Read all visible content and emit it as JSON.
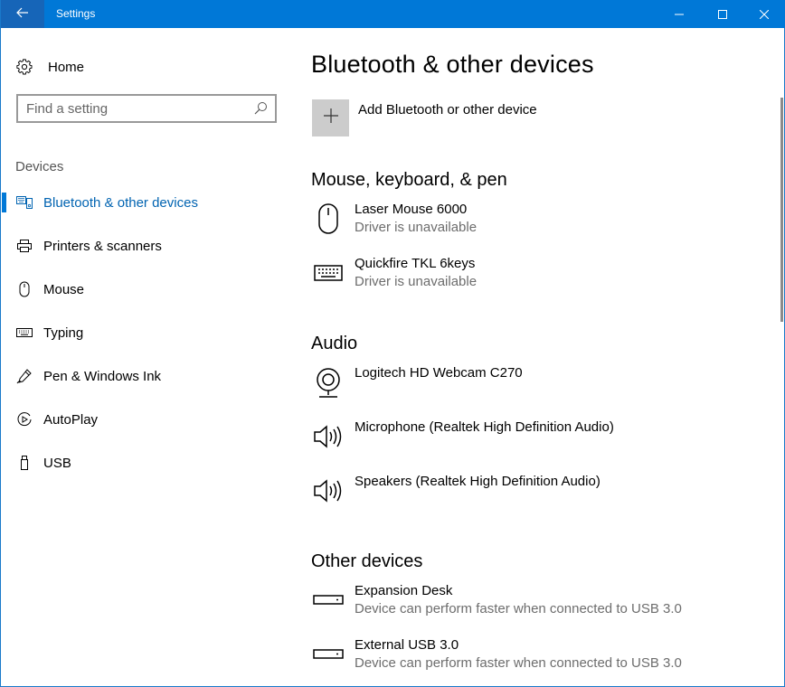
{
  "window": {
    "title": "Settings",
    "accent_color": "#0078d7",
    "controls": [
      "minimize-icon",
      "maximize-icon",
      "close-icon"
    ]
  },
  "sidebar": {
    "home_label": "Home",
    "home_icon": "gear-icon",
    "search": {
      "placeholder": "Find a setting",
      "value": "",
      "icon": "search-icon"
    },
    "section_label": "Devices",
    "items": [
      {
        "label": "Bluetooth & other devices",
        "icon": "bluetooth-devices-icon",
        "active": true
      },
      {
        "label": "Printers & scanners",
        "icon": "printer-icon",
        "active": false
      },
      {
        "label": "Mouse",
        "icon": "mouse-icon",
        "active": false
      },
      {
        "label": "Typing",
        "icon": "keyboard-icon",
        "active": false
      },
      {
        "label": "Pen & Windows Ink",
        "icon": "pen-icon",
        "active": false
      },
      {
        "label": "AutoPlay",
        "icon": "autoplay-icon",
        "active": false
      },
      {
        "label": "USB",
        "icon": "usb-icon",
        "active": false
      }
    ]
  },
  "main": {
    "title": "Bluetooth & other devices",
    "add_device_label": "Add Bluetooth or other device",
    "groups": [
      {
        "title": "Mouse, keyboard, & pen",
        "devices": [
          {
            "name": "Laser Mouse 6000",
            "status": "Driver is unavailable",
            "icon": "mouse-icon"
          },
          {
            "name": "Quickfire TKL 6keys",
            "status": "Driver is unavailable",
            "icon": "keyboard-icon"
          }
        ]
      },
      {
        "title": "Audio",
        "devices": [
          {
            "name": "Logitech HD Webcam C270",
            "status": "",
            "icon": "webcam-icon"
          },
          {
            "name": "Microphone (Realtek High Definition Audio)",
            "status": "",
            "icon": "speaker-icon"
          },
          {
            "name": "Speakers (Realtek High Definition Audio)",
            "status": "",
            "icon": "speaker-icon"
          }
        ]
      },
      {
        "title": "Other devices",
        "devices": [
          {
            "name": "Expansion Desk",
            "status": "Device can perform faster when connected to USB 3.0",
            "icon": "drive-icon"
          },
          {
            "name": "External USB 3.0",
            "status": "Device can perform faster when connected to USB 3.0",
            "icon": "drive-icon"
          }
        ]
      }
    ]
  }
}
